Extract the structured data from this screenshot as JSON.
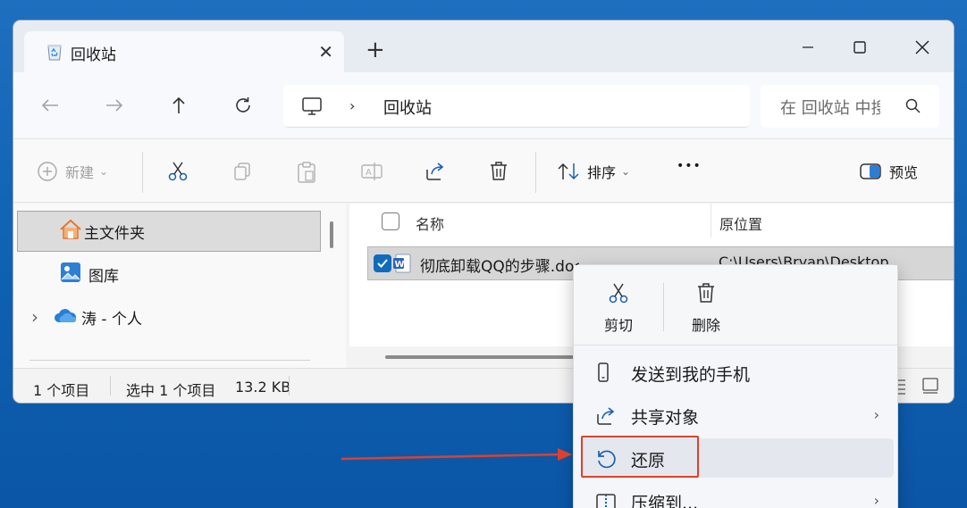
{
  "window": {
    "tab_title": "回收站",
    "tab_close": "✕",
    "new_tab": "+"
  },
  "navigation": {
    "address_path": "回收站",
    "address_separator": "›",
    "search_placeholder": "在 回收站 中搜索"
  },
  "toolbar": {
    "new_label": "新建",
    "new_chevron": "⌄",
    "sort_label": "排序",
    "sort_chevron": "⌄",
    "more_label": "•••",
    "preview_label": "预览"
  },
  "sidebar": {
    "items": [
      {
        "label": "主文件夹"
      },
      {
        "label": "图库"
      },
      {
        "label": "涛 - 个人",
        "expand": "›"
      }
    ]
  },
  "file_list": {
    "columns": [
      "名称",
      "原位置"
    ],
    "rows": [
      {
        "name": "彻底卸载QQ的步骤.docx",
        "location": "C:\\Users\\Bryan\\Desktop",
        "selected": true
      }
    ]
  },
  "status": {
    "item_count": "1 个项目",
    "selection": "选中 1 个项目",
    "size": "13.2 KB"
  },
  "context_menu": {
    "quick_actions": [
      {
        "label": "剪切"
      },
      {
        "label": "删除"
      }
    ],
    "items": [
      {
        "label": "发送到我的手机",
        "submenu": ""
      },
      {
        "label": "共享对象",
        "submenu": "›"
      },
      {
        "label": "还原",
        "submenu": ""
      },
      {
        "label": "压缩到...",
        "submenu": "›"
      }
    ]
  },
  "colors": {
    "accent": "#0f6cbd",
    "highlight": "#e0402a",
    "desktop": "#0f5fb0"
  }
}
